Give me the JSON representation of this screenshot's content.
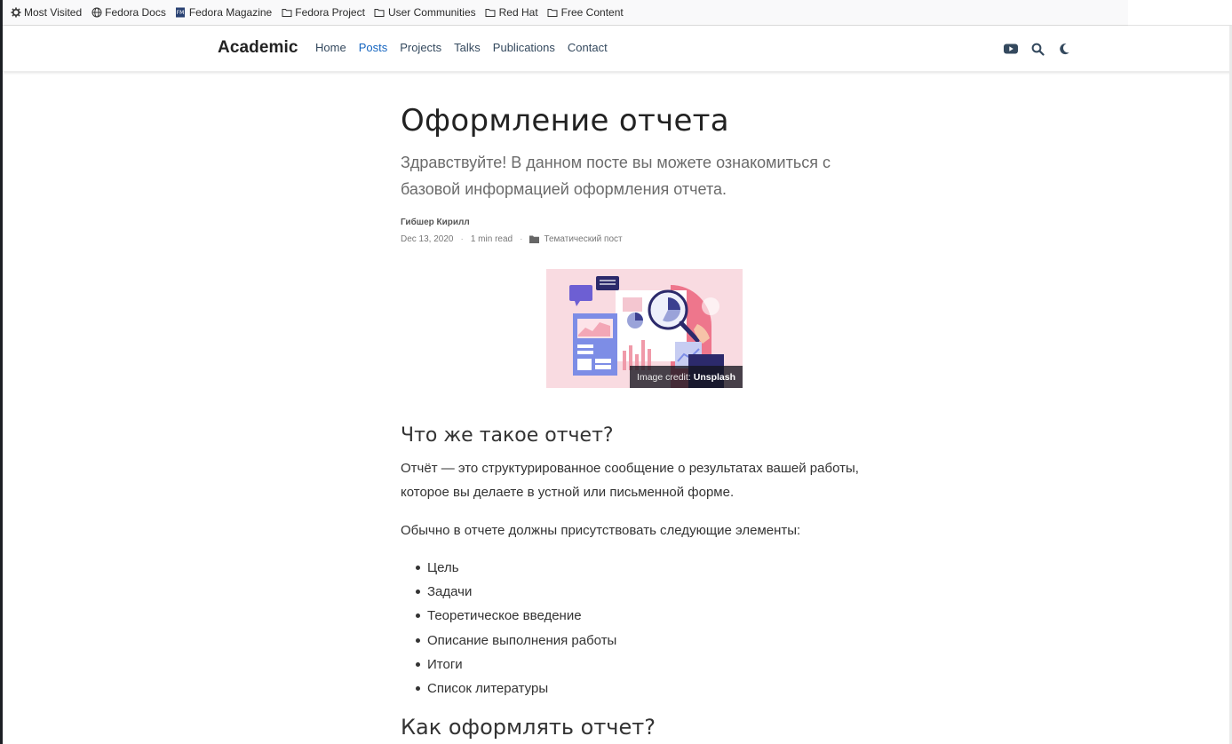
{
  "bookmarks": [
    {
      "label": "Most Visited",
      "icon": "gear-icon"
    },
    {
      "label": "Fedora Docs",
      "icon": "globe-icon"
    },
    {
      "label": "Fedora Magazine",
      "icon": "fedora-magazine-icon"
    },
    {
      "label": "Fedora Project",
      "icon": "folder-icon"
    },
    {
      "label": "User Communities",
      "icon": "folder-icon"
    },
    {
      "label": "Red Hat",
      "icon": "folder-icon"
    },
    {
      "label": "Free Content",
      "icon": "folder-icon"
    }
  ],
  "navbar": {
    "brand": "Academic",
    "links": [
      {
        "label": "Home",
        "active": false
      },
      {
        "label": "Posts",
        "active": true
      },
      {
        "label": "Projects",
        "active": false
      },
      {
        "label": "Talks",
        "active": false
      },
      {
        "label": "Publications",
        "active": false
      },
      {
        "label": "Contact",
        "active": false
      }
    ],
    "icons": [
      "youtube-icon",
      "search-icon",
      "moon-icon"
    ],
    "accent_color": "#1565c0"
  },
  "article": {
    "title": "Оформление отчета",
    "subtitle": "Здравствуйте! В данном посте вы можете ознакомиться с базовой информацией оформления отчета.",
    "author": "Гибшер Кирилл",
    "date": "Dec 13, 2020",
    "read_time": "1 min read",
    "category": "Тематический пост",
    "image_credit_prefix": "Image credit:",
    "image_credit_source": "Unsplash",
    "section1_heading": "Что же такое отчет?",
    "section1_p1": "Отчёт — это структурированное сообщение о результатах вашей работы, которое вы делаете в устной или письменной форме.",
    "section1_p2": "Обычно в отчете должны присутствовать следующие элементы:",
    "elements": [
      "Цель",
      "Задачи",
      "Теоретическое введение",
      "Описание выполнения работы",
      "Итоги",
      "Список литературы"
    ],
    "section2_heading": "Как оформлять отчет?"
  }
}
